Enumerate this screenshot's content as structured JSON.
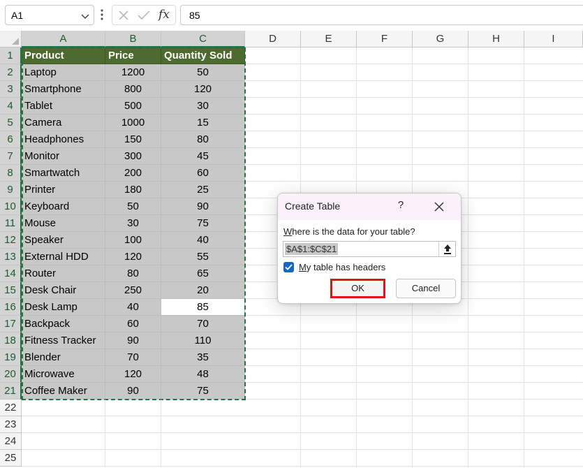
{
  "formula_bar": {
    "name_box_value": "A1",
    "function_symbol": "fx",
    "formula_value": "85"
  },
  "columns": [
    "A",
    "B",
    "C",
    "D",
    "E",
    "F",
    "G",
    "H",
    "I"
  ],
  "rows": [
    "1",
    "2",
    "3",
    "4",
    "5",
    "6",
    "7",
    "8",
    "9",
    "10",
    "11",
    "12",
    "13",
    "14",
    "15",
    "16",
    "17",
    "18",
    "19",
    "20",
    "21",
    "22",
    "23",
    "24",
    "25"
  ],
  "table": {
    "headers": [
      "Product",
      "Price",
      "Quantity Sold"
    ],
    "rows": [
      [
        "Laptop",
        "1200",
        "50"
      ],
      [
        "Smartphone",
        "800",
        "120"
      ],
      [
        "Tablet",
        "500",
        "30"
      ],
      [
        "Camera",
        "1000",
        "15"
      ],
      [
        "Headphones",
        "150",
        "80"
      ],
      [
        "Monitor",
        "300",
        "45"
      ],
      [
        "Smartwatch",
        "200",
        "60"
      ],
      [
        "Printer",
        "180",
        "25"
      ],
      [
        "Keyboard",
        "50",
        "90"
      ],
      [
        "Mouse",
        "30",
        "75"
      ],
      [
        "Speaker",
        "100",
        "40"
      ],
      [
        "External HDD",
        "120",
        "55"
      ],
      [
        "Router",
        "80",
        "65"
      ],
      [
        "Desk Chair",
        "250",
        "20"
      ],
      [
        "Desk Lamp",
        "40",
        "85"
      ],
      [
        "Backpack",
        "60",
        "70"
      ],
      [
        "Fitness Tracker",
        "90",
        "110"
      ],
      [
        "Blender",
        "70",
        "35"
      ],
      [
        "Microwave",
        "120",
        "48"
      ],
      [
        "Coffee Maker",
        "90",
        "75"
      ]
    ]
  },
  "dialog": {
    "title": "Create Table",
    "help_label": "?",
    "range_prompt": "Where is the data for your table?",
    "range_value": "$A$1:$C$21",
    "headers_checkbox_label": "My table has headers",
    "headers_checked": true,
    "ok_label": "OK",
    "cancel_label": "Cancel"
  },
  "colors": {
    "header_fill": "#4e6b2f",
    "data_fill": "#c8c8c8",
    "selection_green": "#217346",
    "highlight_red": "#e0141b",
    "checkbox_blue": "#1865c4"
  }
}
